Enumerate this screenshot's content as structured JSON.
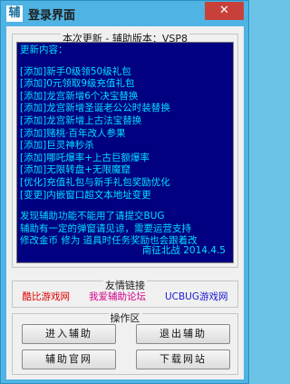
{
  "window": {
    "title": "登录界面",
    "app_icon_glyph": "辅",
    "close_glyph": "✕",
    "colors": {
      "frame": "#4fb3e3",
      "close": "#c7413a"
    }
  },
  "update_group": {
    "legend": "本次更新 - 辅助版本：VSP8",
    "lines": [
      "更新内容：",
      "",
      "[添加]新手0级领50级礼包",
      "[添加]0元领取9级充值礼包",
      "[添加]龙宫新增6个决宝替换",
      "[添加]龙宫新增圣诞老公公时装替换",
      "[添加]龙宫新增上古法宝替换",
      "[添加]赌桃·百年改人参果",
      "[添加]巨灵神秒杀",
      "[添加]哪吒爆率+上古巨额爆率",
      "[添加]无限转盘+无限魔窟",
      "[优化]充值礼包与新手礼包奖励优化",
      "[变更]内嵌窗口超文本地址变更",
      "",
      "发现辅助功能不能用了请提交BUG",
      "辅助有一定的弹窗请见谅，需要运营支持",
      "修改金币 修为 道具时任务奖励也会跟着改"
    ],
    "signature": "南征北战 2014.4.5",
    "text_color": "#00e0ff",
    "background": "#000080"
  },
  "links_group": {
    "legend": "友情链接",
    "links": [
      {
        "label": "酷比游戏网",
        "color": "#e00000"
      },
      {
        "label": "我爱辅助论坛",
        "color": "#d4008a"
      },
      {
        "label": "UCBUG游戏网",
        "color": "#1a1ad0"
      }
    ]
  },
  "ops_group": {
    "legend": "操作区",
    "buttons": {
      "enter": "进入辅助",
      "exit": "退出辅助",
      "official": "辅助官网",
      "download": "下载网站"
    }
  }
}
